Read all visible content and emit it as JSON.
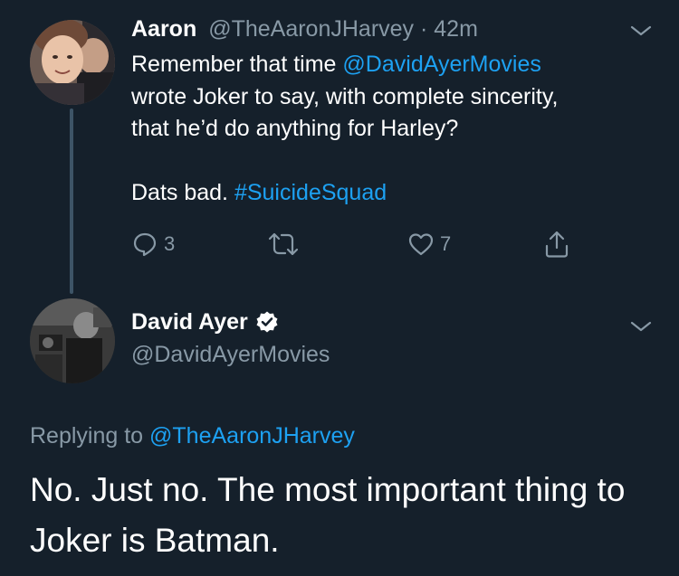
{
  "tweet1": {
    "name": "Aaron",
    "handle": "@TheAaronJHarvey",
    "separator": " · ",
    "time": "42m",
    "line1_prefix": "Remember that time ",
    "mention": "@DavidAyerMovies",
    "line2": "wrote Joker to say, with complete sincerity,",
    "line3": "that he’d do anything for Harley?",
    "line4_prefix": "Dats bad. ",
    "hashtag": "#SuicideSquad",
    "reply_count": "3",
    "like_count": "7"
  },
  "tweet2": {
    "name": "David Ayer",
    "handle": "@DavidAyerMovies",
    "replying_prefix": "Replying to ",
    "replying_to": "@TheAaronJHarvey",
    "body": "No. Just no. The most important thing to Joker is Batman."
  },
  "icons": {
    "reply": "reply-icon",
    "retweet": "retweet-icon",
    "like": "like-icon",
    "share": "share-icon",
    "menu": "chevron-down-icon",
    "verified": "verified-badge-icon"
  },
  "colors": {
    "background": "#15202b",
    "primary_text": "#ffffff",
    "secondary_text": "#8899a6",
    "link": "#1da1f2",
    "thread_line": "#3d5466"
  }
}
